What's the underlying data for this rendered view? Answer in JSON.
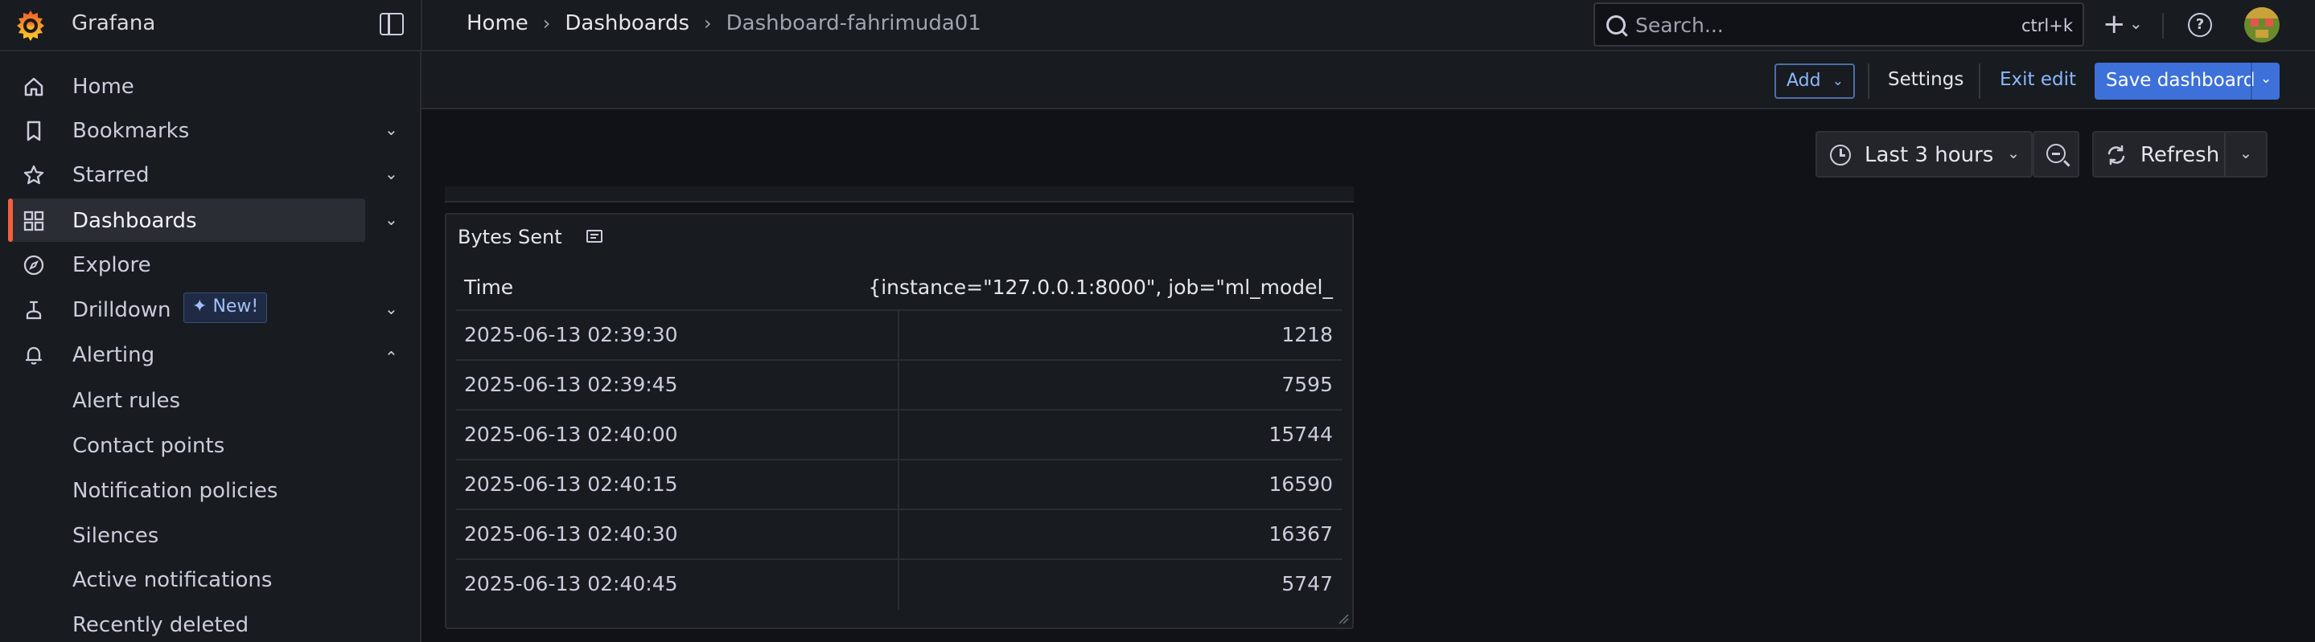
{
  "app": {
    "title": "Grafana"
  },
  "breadcrumb": [
    "Home",
    "Dashboards",
    "Dashboard-fahrimuda01"
  ],
  "search": {
    "placeholder": "Search...",
    "shortcut": "ctrl+k"
  },
  "sidebar": {
    "items": [
      {
        "label": "Home",
        "icon": "home-icon"
      },
      {
        "label": "Bookmarks",
        "icon": "bookmark-icon"
      },
      {
        "label": "Starred",
        "icon": "star-icon"
      },
      {
        "label": "Dashboards",
        "icon": "apps-icon"
      },
      {
        "label": "Explore",
        "icon": "compass-icon"
      },
      {
        "label": "Drilldown",
        "icon": "drilldown-icon",
        "badge": "New!"
      },
      {
        "label": "Alerting",
        "icon": "bell-icon"
      }
    ],
    "alerting_sub": [
      "Alert rules",
      "Contact points",
      "Notification policies",
      "Silences",
      "Active notifications",
      "Recently deleted"
    ]
  },
  "toolbar": {
    "add": "Add",
    "settings": "Settings",
    "exit_edit": "Exit edit",
    "save": "Save dashboard"
  },
  "time": {
    "range": "Last 3 hours",
    "refresh": "Refresh"
  },
  "panel": {
    "title": "Bytes Sent",
    "columns": [
      "Time",
      "{instance=\"127.0.0.1:8000\", job=\"ml_model_"
    ],
    "rows": [
      {
        "time": "2025-06-13 02:39:30",
        "value": "1218"
      },
      {
        "time": "2025-06-13 02:39:45",
        "value": "7595"
      },
      {
        "time": "2025-06-13 02:40:00",
        "value": "15744"
      },
      {
        "time": "2025-06-13 02:40:15",
        "value": "16590"
      },
      {
        "time": "2025-06-13 02:40:30",
        "value": "16367"
      },
      {
        "time": "2025-06-13 02:40:45",
        "value": "5747"
      }
    ]
  },
  "colors": {
    "accent": "#f55f3e",
    "primary": "#3d71d9",
    "link": "#8ab8ff",
    "bg": "#111217",
    "panel": "#181b1f"
  }
}
